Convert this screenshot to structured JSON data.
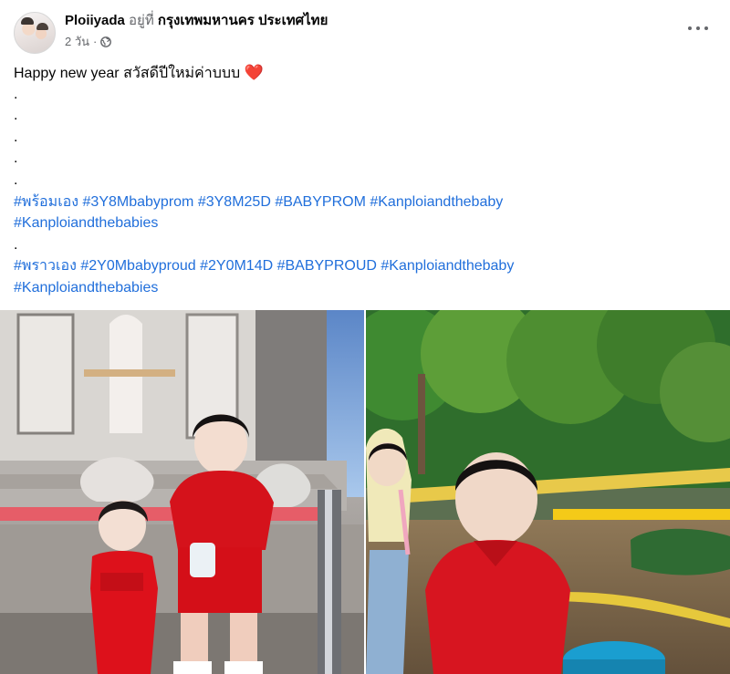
{
  "post": {
    "author": "Ploiiyada",
    "at_text": "อยู่ที่",
    "location": "กรุงเทพมหานคร ประเทศไทย",
    "time": "2 วัน",
    "dot": "·",
    "text_line1": "Happy new year สวัสดีปีใหม่ค่าบบบ",
    "heart": "❤️",
    "dots": [
      ".",
      ".",
      ".",
      ".",
      "."
    ],
    "tags_block1_line1": "#พร้อมเอง #3Y8Mbabyprom #3Y8M25D #BABYPROM #Kanploiandthebaby",
    "tags_block1_line2": "#Kanploiandthebabies",
    "separator": ".",
    "tags_block2_line1": "#พราวเอง  #2Y0Mbabyproud #2Y0M14D #BABYPROUD #Kanploiandthebaby",
    "tags_block2_line2": "#Kanploiandthebabies"
  },
  "icons": {
    "globe": "globe-icon",
    "more": "more-options-icon",
    "heart": "heart-emoji"
  },
  "colors": {
    "link": "#216fdb",
    "secondary_text": "#65676b",
    "heart": "#e41e3f"
  }
}
